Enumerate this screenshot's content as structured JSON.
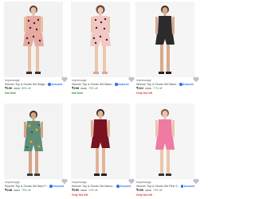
{
  "products": [
    {
      "brand": "Impressage",
      "name": "Women Top & Shorts Set Beige...",
      "assured": "Assured",
      "price": "₹196",
      "mrp": "₹999",
      "off": "80% off",
      "tag": "Hot Deal",
      "tag_color": "green",
      "outfit_color": "#e8a9a0",
      "pattern": "hearts"
    },
    {
      "brand": "Impressage",
      "name": "Women Top & Shorts Set Black...",
      "assured": "Assured",
      "price": "₹208",
      "mrp": "₹999",
      "off": "79% off",
      "tag": "Hot Deal",
      "tag_color": "green",
      "outfit_color": "#f4c7c5",
      "pattern": "hearts"
    },
    {
      "brand": "Impressage",
      "name": "Women Top & Shorts Set Black...",
      "assured": "Assured",
      "price": "₹222",
      "mrp": "₹999",
      "off": "77% off",
      "tag": "Only few left",
      "tag_color": "red",
      "outfit_color": "#2b2b2b",
      "pattern": "solid"
    },
    {
      "brand": "Impressage",
      "name": "Women Top & Shorts Set Blue Printed...",
      "assured": "Assured",
      "price": "₹248",
      "mrp": "₹999",
      "off": "75% off",
      "tag": "",
      "tag_color": "",
      "outfit_color": "#5b8f7a",
      "pattern": "tropical"
    },
    {
      "brand": "Impressage",
      "name": "Women Top & Shorts Set Maroon...",
      "assured": "Assured",
      "price": "₹250",
      "mrp": "₹999",
      "off": "74% off",
      "tag": "Only few left",
      "tag_color": "red",
      "outfit_color": "#7a1222",
      "pattern": "solid"
    },
    {
      "brand": "Impressage",
      "name": "Women Top & Shorts Set Pink S...",
      "assured": "Assured",
      "price": "₹250",
      "mrp": "₹999",
      "off": "74% off",
      "tag": "Only few left",
      "tag_color": "red",
      "outfit_color": "#ef7ba2",
      "pattern": "solid"
    }
  ]
}
